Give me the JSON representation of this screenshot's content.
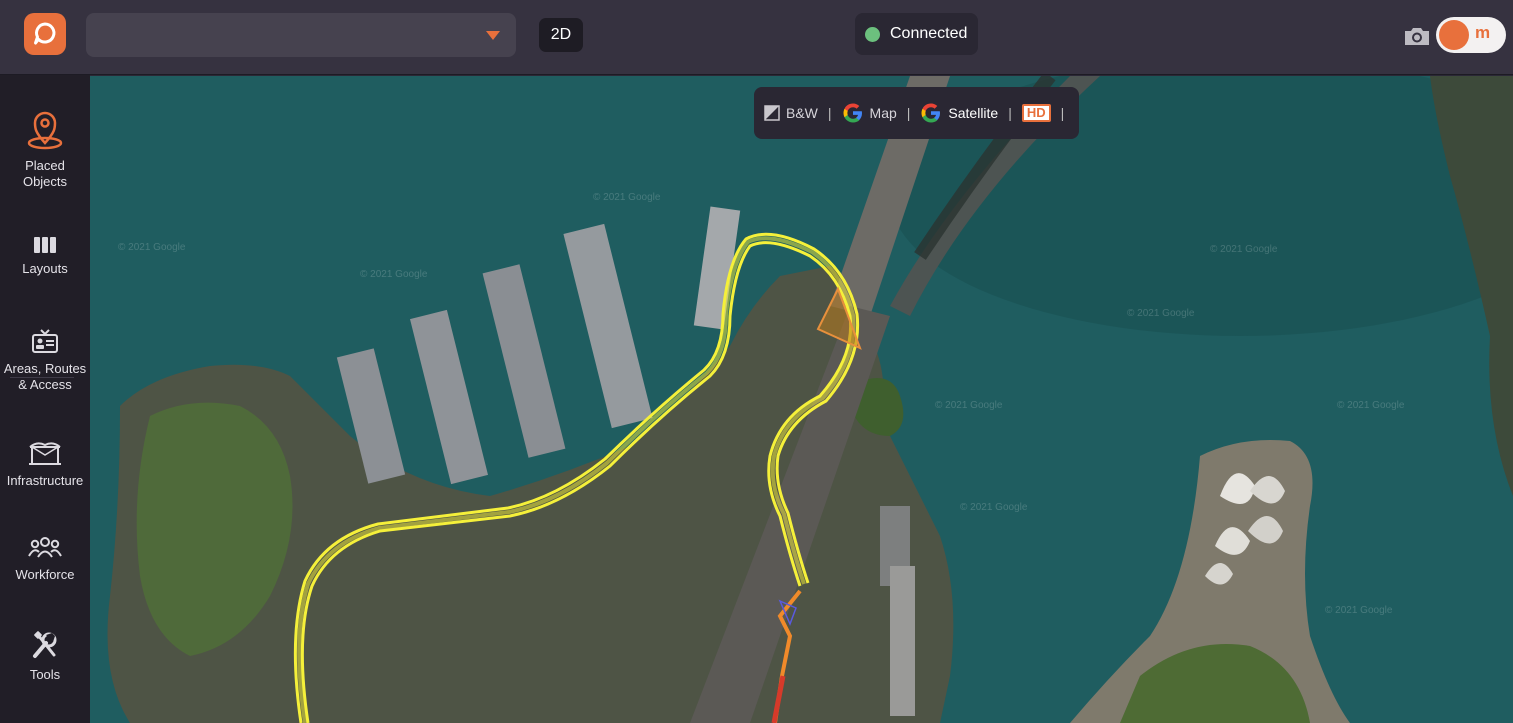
{
  "topbar": {
    "project_select_value": "",
    "view_mode_button": "2D",
    "connection_status": "Connected",
    "user_initial": "m"
  },
  "sidebar": {
    "items": [
      {
        "label_line1": "Placed",
        "label_line2": "Objects",
        "icon": "location-pin-icon"
      },
      {
        "label_line1": "Layouts",
        "label_line2": "",
        "icon": "layout-columns-icon"
      },
      {
        "label_line1": "Areas, Routes",
        "label_line2": "& Access",
        "icon": "id-card-icon"
      },
      {
        "label_line1": "Infrastructure",
        "label_line2": "",
        "icon": "tent-structure-icon"
      },
      {
        "label_line1": "Workforce",
        "label_line2": "",
        "icon": "people-group-icon"
      },
      {
        "label_line1": "Tools",
        "label_line2": "",
        "icon": "tools-icon"
      }
    ]
  },
  "map_toolbar": {
    "bw_label": "B&W",
    "map_label": "Map",
    "satellite_label": "Satellite",
    "hd_label": "HD",
    "separator": "|"
  },
  "map": {
    "watermark_text": "© 2021 Google"
  },
  "colors": {
    "accent": "#e8703c",
    "route": "#f5f03a",
    "connected": "#6cc07e",
    "water": "#1e5a5c"
  }
}
